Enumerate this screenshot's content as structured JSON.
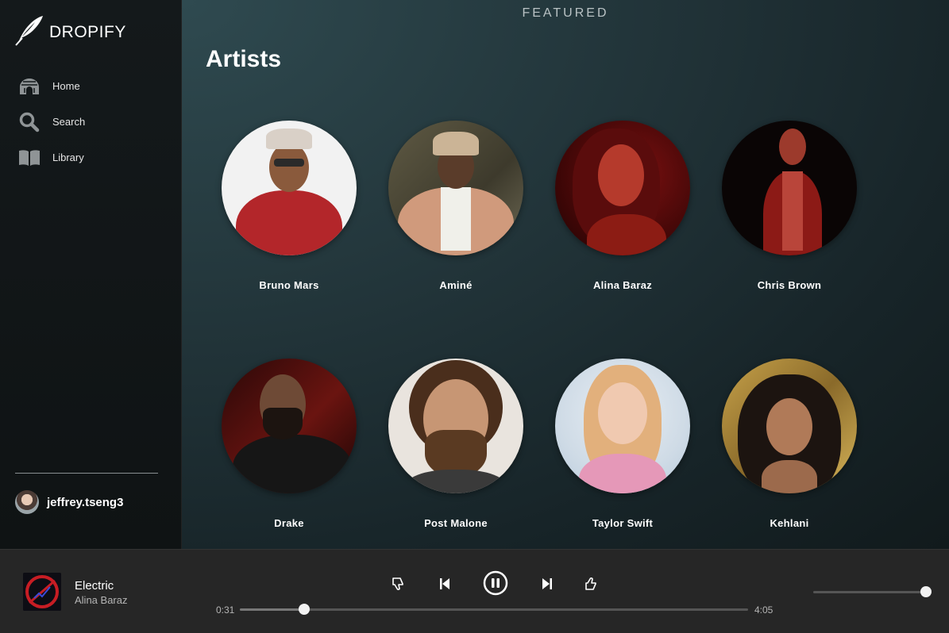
{
  "app": {
    "brand": "DROPIFY"
  },
  "sidebar": {
    "items": [
      {
        "label": "Home",
        "icon": "home-icon"
      },
      {
        "label": "Search",
        "icon": "search-icon"
      },
      {
        "label": "Library",
        "icon": "library-icon"
      }
    ],
    "user": {
      "name": "jeffrey.tseng3"
    }
  },
  "main": {
    "featured": "FEATURED",
    "section_title": "Artists",
    "artists": [
      {
        "name": "Bruno Mars"
      },
      {
        "name": "Aminé"
      },
      {
        "name": "Alina Baraz"
      },
      {
        "name": "Chris Brown"
      },
      {
        "name": "Drake"
      },
      {
        "name": "Post Malone"
      },
      {
        "name": "Taylor Swift"
      },
      {
        "name": "Kehlani"
      }
    ]
  },
  "player": {
    "track_title": "Electric",
    "track_artist": "Alina Baraz",
    "elapsed": "0:31",
    "duration": "4:05",
    "progress": 0.127,
    "volume": 1.0
  },
  "colors": {
    "sidebar_bg": "#12171a",
    "main_bg": "#213338",
    "player_bg": "#262626",
    "accent": "#ffffff"
  }
}
